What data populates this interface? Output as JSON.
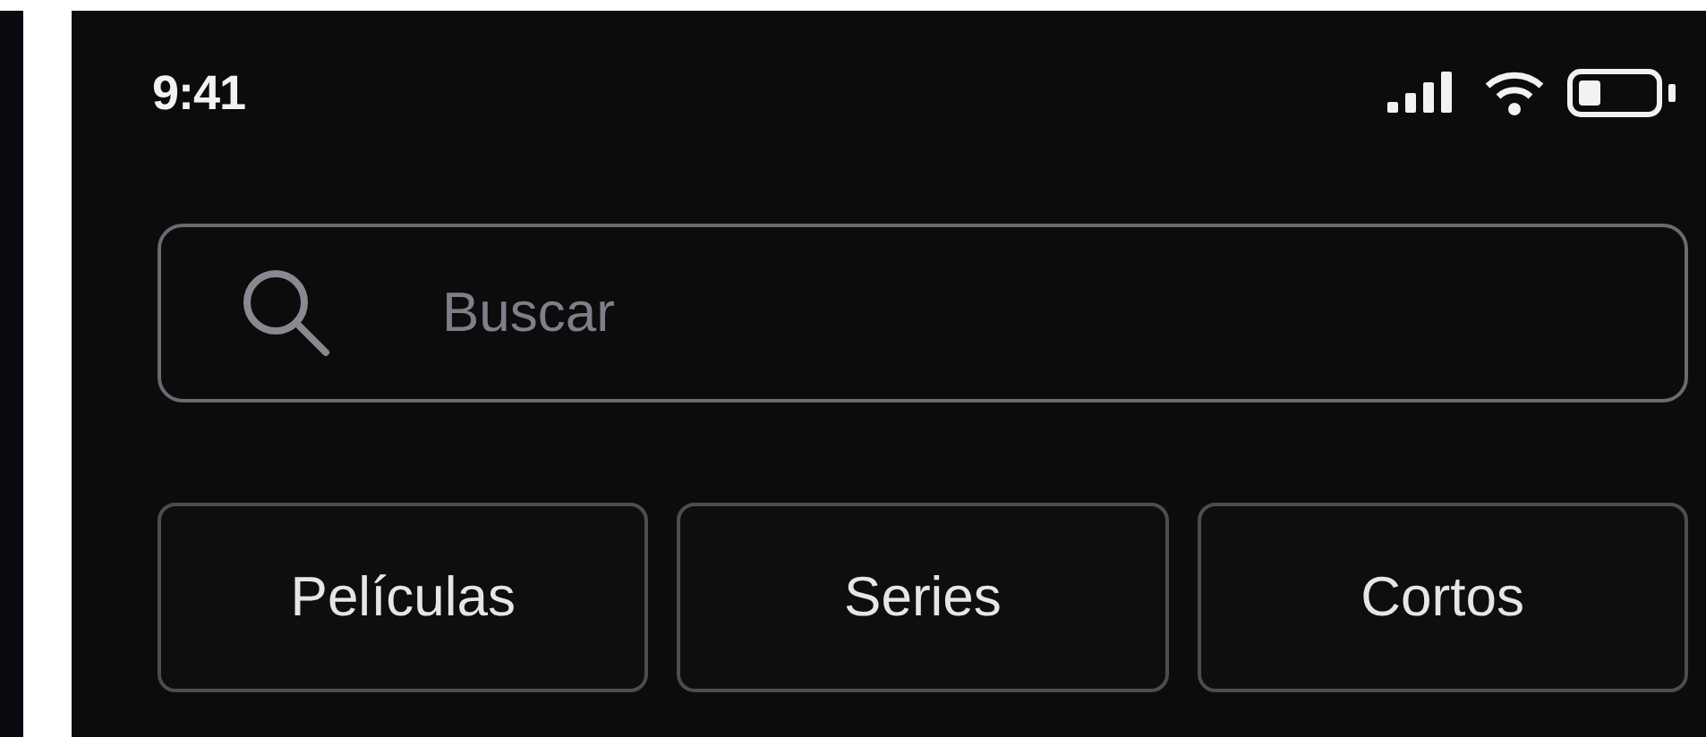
{
  "status_bar": {
    "time": "9:41"
  },
  "search": {
    "placeholder": "Buscar"
  },
  "categories": [
    {
      "label": "Películas"
    },
    {
      "label": "Series"
    },
    {
      "label": "Cortos"
    }
  ]
}
